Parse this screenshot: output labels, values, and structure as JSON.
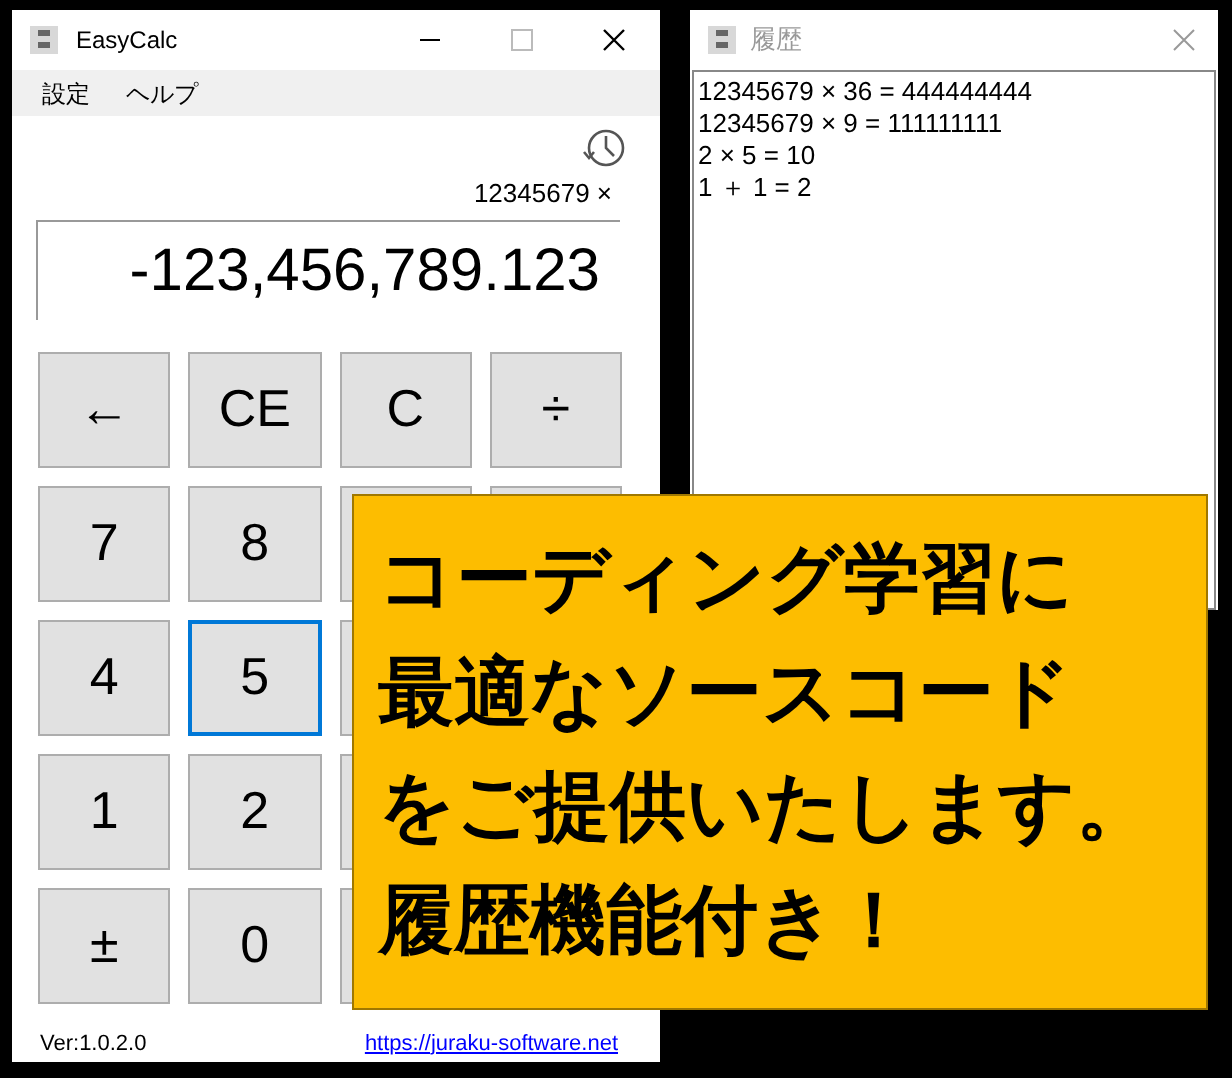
{
  "calc_window": {
    "title": "EasyCalc",
    "menu": [
      "設定",
      "ヘルプ"
    ],
    "expression": "12345679 ×",
    "display": "-123,456,789.123",
    "keypad": [
      [
        {
          "label": "←",
          "focused": false
        },
        {
          "label": "CE",
          "focused": false
        },
        {
          "label": "C",
          "focused": false
        },
        {
          "label": "÷",
          "focused": false
        }
      ],
      [
        {
          "label": "7",
          "focused": false
        },
        {
          "label": "8",
          "focused": false
        }
      ],
      [
        {
          "label": "4",
          "focused": false
        },
        {
          "label": "5",
          "focused": true
        }
      ],
      [
        {
          "label": "1",
          "focused": false
        },
        {
          "label": "2",
          "focused": false
        }
      ],
      [
        {
          "label": "±",
          "focused": false
        },
        {
          "label": "0",
          "focused": false
        }
      ]
    ],
    "version": "Ver:1.0.2.0",
    "link": "https://juraku-software.net"
  },
  "history_window": {
    "title": "履歴",
    "entries": [
      "12345679 × 36 = 444444444",
      "12345679 × 9 = 111111111",
      "2 × 5 = 10",
      "1 ＋ 1 = 2"
    ]
  },
  "banner": {
    "lines": [
      "コーディング学習に",
      "最適なソースコード",
      "をご提供いたします。",
      "履歴機能付き！"
    ]
  }
}
